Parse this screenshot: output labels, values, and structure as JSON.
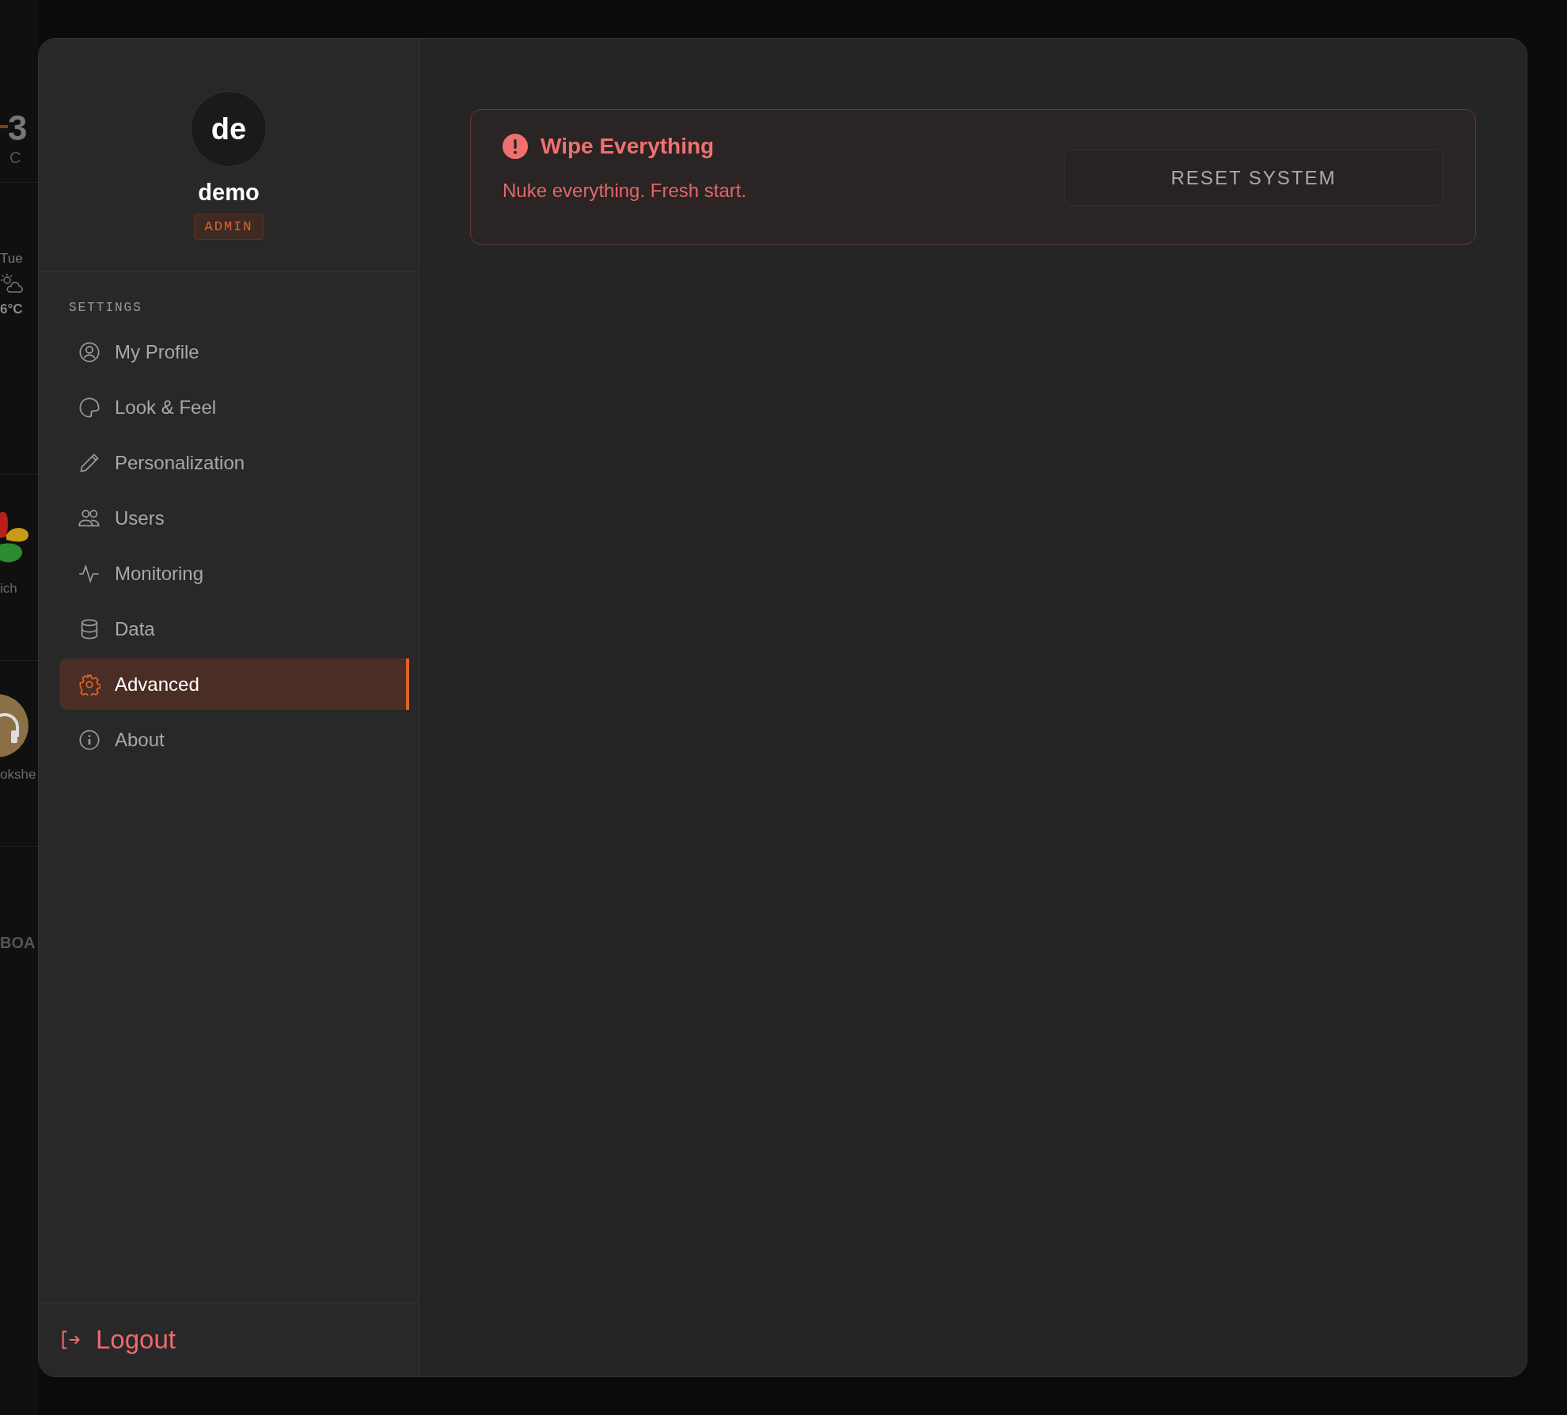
{
  "background_dashboard": {
    "widget": {
      "value": "3",
      "unit": "C"
    },
    "weather": {
      "day": "Tue",
      "temperature": "6°C"
    },
    "apps": [
      {
        "label": "ich"
      },
      {
        "label": "okshe"
      }
    ],
    "section_heading": "BOA"
  },
  "profile": {
    "avatar_initials": "de",
    "username": "demo",
    "role": "ADMIN"
  },
  "sidebar": {
    "section_label": "SETTINGS",
    "items": [
      {
        "label": "My Profile",
        "selected": false
      },
      {
        "label": "Look & Feel",
        "selected": false
      },
      {
        "label": "Personalization",
        "selected": false
      },
      {
        "label": "Users",
        "selected": false
      },
      {
        "label": "Monitoring",
        "selected": false
      },
      {
        "label": "Data",
        "selected": false
      },
      {
        "label": "Advanced",
        "selected": true
      },
      {
        "label": "About",
        "selected": false
      }
    ]
  },
  "danger_card": {
    "title": "Wipe Everything",
    "description": "Nuke everything. Fresh start.",
    "button": "RESET SYSTEM"
  },
  "logout": {
    "label": "Logout"
  }
}
